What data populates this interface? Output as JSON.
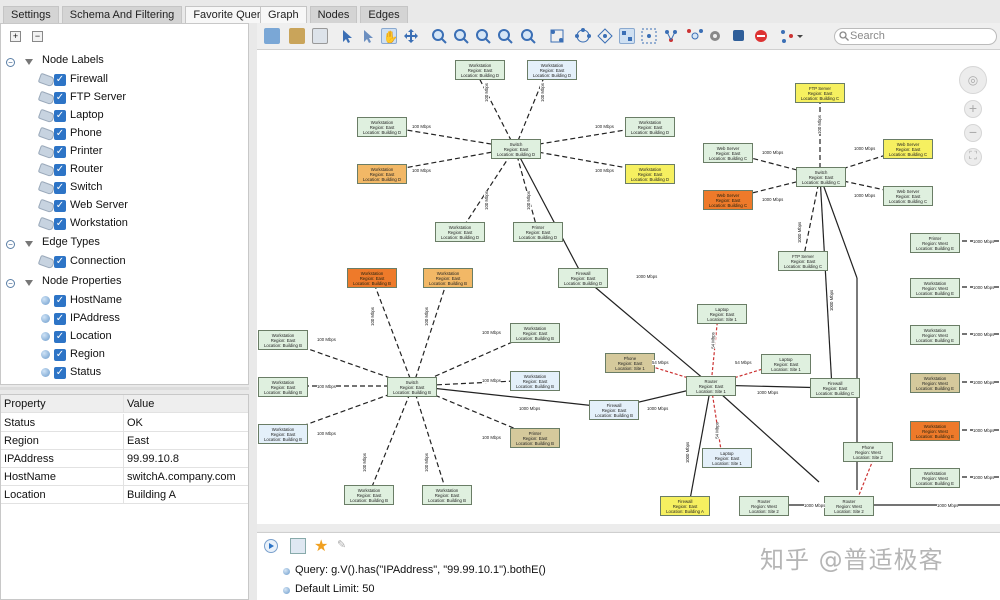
{
  "left_tabs": [
    "Settings",
    "Schema And Filtering",
    "Favorite Queries"
  ],
  "graph_tabs": [
    "Graph",
    "Nodes",
    "Edges"
  ],
  "tree": {
    "expand_all": "+",
    "collapse_all": "−",
    "node_labels": {
      "title": "Node Labels",
      "items": [
        "Firewall",
        "FTP Server",
        "Laptop",
        "Phone",
        "Printer",
        "Router",
        "Switch",
        "Web Server",
        "Workstation"
      ]
    },
    "edge_types": {
      "title": "Edge Types",
      "items": [
        "Connection"
      ]
    },
    "node_properties": {
      "title": "Node Properties",
      "items": [
        "HostName",
        "IPAddress",
        "Location",
        "Region",
        "Status"
      ]
    }
  },
  "properties": {
    "headers": [
      "Property",
      "Value"
    ],
    "rows": [
      [
        "Status",
        "OK"
      ],
      [
        "Region",
        "East"
      ],
      [
        "IPAddress",
        "99.99.10.8"
      ],
      [
        "HostName",
        "switchA.company.com"
      ],
      [
        "Location",
        "Building A"
      ]
    ]
  },
  "search": {
    "placeholder": "Search"
  },
  "graph": {
    "nodes": [
      {
        "id": "ws-d1",
        "l1": "Workstation",
        "l2": "Region: East",
        "l3": "Location: Building D",
        "color": "green"
      },
      {
        "id": "ws-d2",
        "l1": "Workstation",
        "l2": "Region: East",
        "l3": "Location: Building D",
        "color": "blue"
      },
      {
        "id": "ws-d3",
        "l1": "Workstation",
        "l2": "Region: East",
        "l3": "Location: Building D",
        "color": "green"
      },
      {
        "id": "ws-d4",
        "l1": "Workstation",
        "l2": "Region: East",
        "l3": "Location: Building D",
        "color": "green"
      },
      {
        "id": "ws-d5",
        "l1": "Workstation",
        "l2": "Region: East",
        "l3": "Location: Building D",
        "color": "peach"
      },
      {
        "id": "ws-d6",
        "l1": "Workstation",
        "l2": "Region: East",
        "l3": "Location: Building D",
        "color": "yellow"
      },
      {
        "id": "sw-d",
        "l1": "Switch",
        "l2": "Region: East",
        "l3": "Location: Building D",
        "color": "green"
      },
      {
        "id": "ws-d7",
        "l1": "Workstation",
        "l2": "Region: East",
        "l3": "Location: Building D",
        "color": "green"
      },
      {
        "id": "pr-d",
        "l1": "Printer",
        "l2": "Region: East",
        "l3": "Location: Building D",
        "color": "green"
      },
      {
        "id": "fw-d",
        "l1": "Firewall",
        "l2": "Region: East",
        "l3": "Location: Building D",
        "color": "green"
      },
      {
        "id": "ftp-c1",
        "l1": "FTP Server",
        "l2": "Region: East",
        "l3": "Location: Building C",
        "color": "yellow"
      },
      {
        "id": "web-c1",
        "l1": "Web Server",
        "l2": "Region: East",
        "l3": "Location: Building C",
        "color": "green"
      },
      {
        "id": "web-c2",
        "l1": "Web Server",
        "l2": "Region: East",
        "l3": "Location: Building C",
        "color": "yellow"
      },
      {
        "id": "sw-c",
        "l1": "Switch",
        "l2": "Region: East",
        "l3": "Location: Building C",
        "color": "green"
      },
      {
        "id": "web-c3",
        "l1": "Web Server",
        "l2": "Region: East",
        "l3": "Location: Building C",
        "color": "orange"
      },
      {
        "id": "web-c4",
        "l1": "Web Server",
        "l2": "Region: East",
        "l3": "Location: Building C",
        "color": "green"
      },
      {
        "id": "ftp-c2",
        "l1": "FTP Server",
        "l2": "Region: East",
        "l3": "Location: Building C",
        "color": "green"
      },
      {
        "id": "pr-w",
        "l1": "Printer",
        "l2": "Region: West",
        "l3": "Location: Building E",
        "color": "green"
      },
      {
        "id": "ws-b1",
        "l1": "Workstation",
        "l2": "Region: East",
        "l3": "Location: Building B",
        "color": "orange"
      },
      {
        "id": "ws-b2",
        "l1": "Workstation",
        "l2": "Region: East",
        "l3": "Location: Building B",
        "color": "peach"
      },
      {
        "id": "ws-b3",
        "l1": "Workstation",
        "l2": "Region: East",
        "l3": "Location: Building B",
        "color": "green"
      },
      {
        "id": "ws-b4",
        "l1": "Workstation",
        "l2": "Region: East",
        "l3": "Location: Building B",
        "color": "green"
      },
      {
        "id": "sw-b",
        "l1": "Switch",
        "l2": "Region: East",
        "l3": "Location: Building B",
        "color": "green"
      },
      {
        "id": "ws-b5",
        "l1": "Workstation",
        "l2": "Region: East",
        "l3": "Location: Building B",
        "color": "green"
      },
      {
        "id": "ws-b6",
        "l1": "Workstation",
        "l2": "Region: East",
        "l3": "Location: Building B",
        "color": "blue"
      },
      {
        "id": "ws-b7",
        "l1": "Workstation",
        "l2": "Region: East",
        "l3": "Location: Building B",
        "color": "blue"
      },
      {
        "id": "pr-b",
        "l1": "Printer",
        "l2": "Region: East",
        "l3": "Location: Building B",
        "color": "tan"
      },
      {
        "id": "ws-b8",
        "l1": "Workstation",
        "l2": "Region: East",
        "l3": "Location: Building B",
        "color": "green"
      },
      {
        "id": "ws-b9",
        "l1": "Workstation",
        "l2": "Region: East",
        "l3": "Location: Building B",
        "color": "green"
      },
      {
        "id": "fw-b",
        "l1": "Firewall",
        "l2": "Region: East",
        "l3": "Location: Building B",
        "color": "blue"
      },
      {
        "id": "lap-1",
        "l1": "Laptop",
        "l2": "Region: East",
        "l3": "Location: Site 1",
        "color": "green"
      },
      {
        "id": "ph-1",
        "l1": "Phone",
        "l2": "Region: East",
        "l3": "Location: Site 1",
        "color": "tan"
      },
      {
        "id": "lap-2",
        "l1": "Laptop",
        "l2": "Region: East",
        "l3": "Location: Site 1",
        "color": "green"
      },
      {
        "id": "rt-1",
        "l1": "Router",
        "l2": "Region: East",
        "l3": "Location: Site 1",
        "color": "green"
      },
      {
        "id": "lap-3",
        "l1": "Laptop",
        "l2": "Region: East",
        "l3": "Location: Site 1",
        "color": "blue"
      },
      {
        "id": "fw-c",
        "l1": "Firewall",
        "l2": "Region: East",
        "l3": "Location: Building C",
        "color": "green"
      },
      {
        "id": "fw-a",
        "l1": "Firewall",
        "l2": "Region: East",
        "l3": "Location: Building A",
        "color": "yellow"
      },
      {
        "id": "rt-w1",
        "l1": "Router",
        "l2": "Region: West",
        "l3": "Location: Site 2",
        "color": "green"
      },
      {
        "id": "rt-w2",
        "l1": "Router",
        "l2": "Region: West",
        "l3": "Location: Site 2",
        "color": "green"
      },
      {
        "id": "ph-w",
        "l1": "Phone",
        "l2": "Region: West",
        "l3": "Location: Site 2",
        "color": "green"
      },
      {
        "id": "ws-e1",
        "l1": "Workstation",
        "l2": "Region: West",
        "l3": "Location: Building E",
        "color": "green"
      },
      {
        "id": "ws-e2",
        "l1": "Workstation",
        "l2": "Region: West",
        "l3": "Location: Building E",
        "color": "green"
      },
      {
        "id": "ws-e3",
        "l1": "Workstation",
        "l2": "Region: West",
        "l3": "Location: Building E",
        "color": "tan"
      },
      {
        "id": "ws-e4",
        "l1": "Workstation",
        "l2": "Region: West",
        "l3": "Location: Building E",
        "color": "orange"
      },
      {
        "id": "ws-e5",
        "l1": "Workstation",
        "l2": "Region: West",
        "l3": "Location: Building E",
        "color": "green"
      }
    ],
    "edge_labels": {
      "mbps100": "100 Mbps",
      "mbps1000": "1000 Mbps",
      "mbps54": "54 Mbps"
    }
  },
  "query": {
    "text": "Query: g.V().has(\"IPAddress\", \"99.99.10.1\").bothE()",
    "limit": "Default Limit: 50"
  },
  "watermark": "知乎 @普适极客",
  "colors": {
    "green": "#dff0df",
    "orange": "#ee7a2a",
    "peach": "#f2b866",
    "yellow": "#f6f060",
    "tan": "#d5c99c",
    "blue": "#e4f0fa",
    "accent": "#2d74c6"
  }
}
